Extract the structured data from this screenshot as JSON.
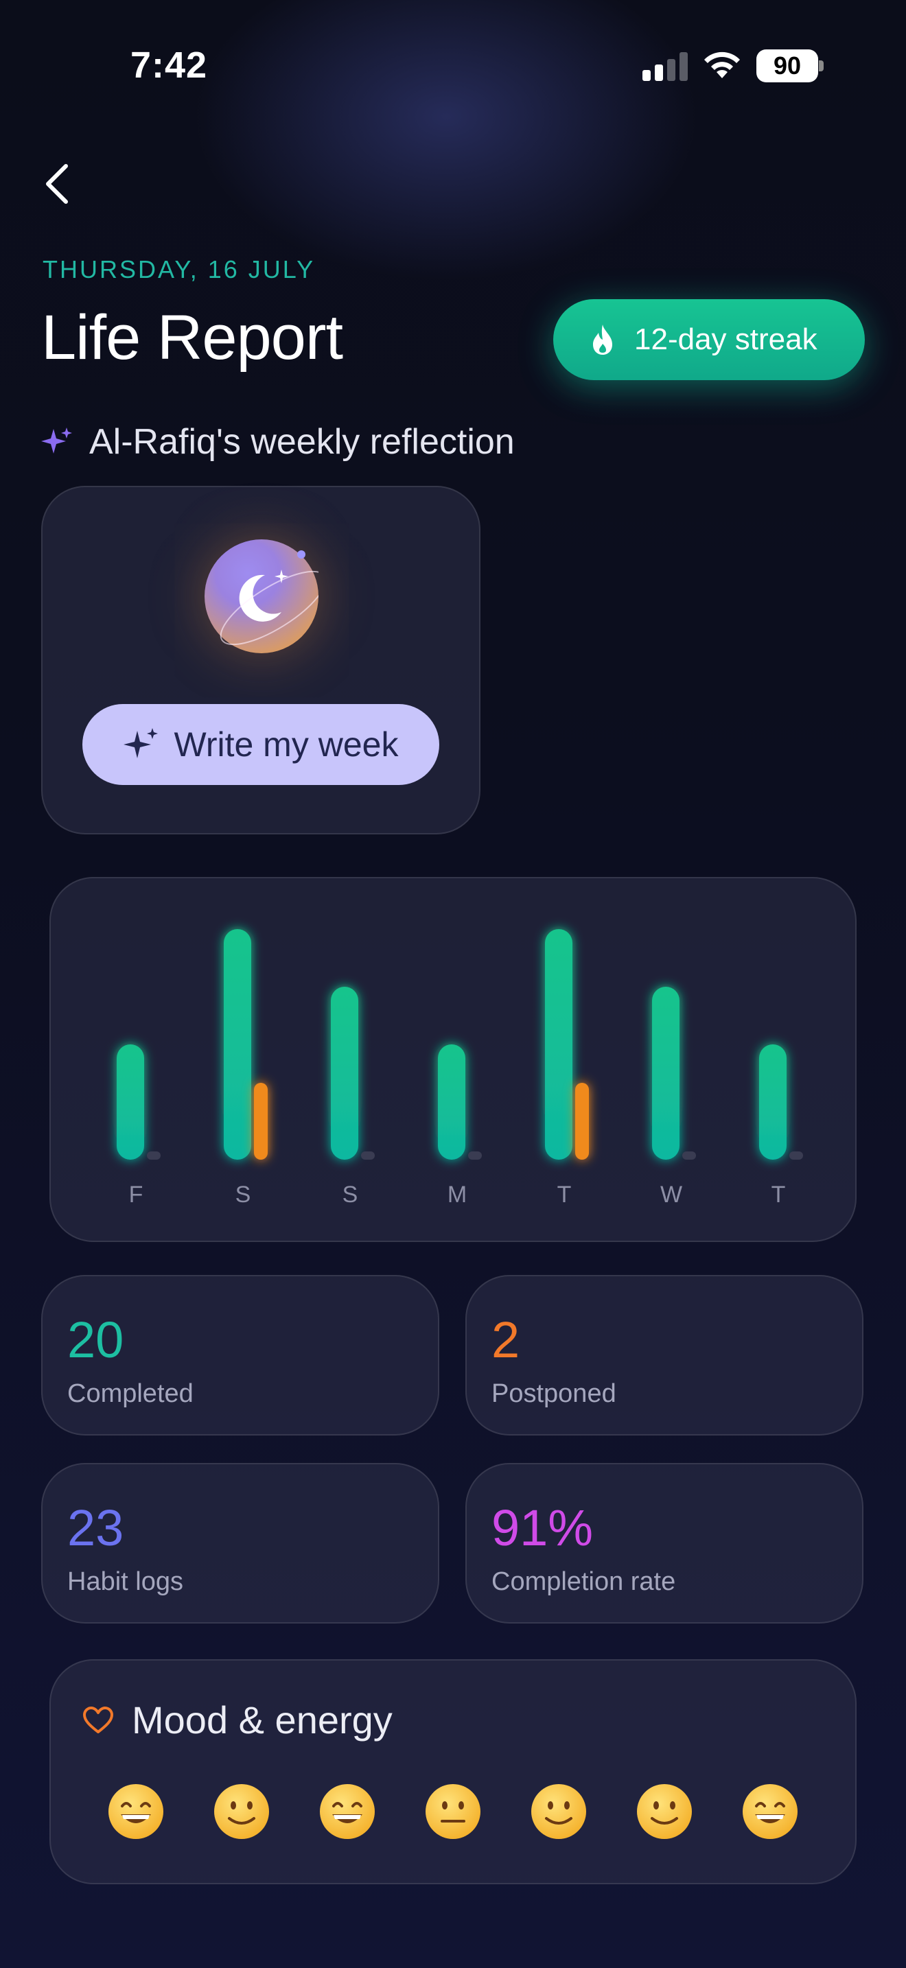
{
  "status_bar": {
    "time": "7:42",
    "battery": "90"
  },
  "header": {
    "date": "THURSDAY, 16 JULY",
    "title": "Life Report",
    "streak_label": "12-day streak"
  },
  "reflection": {
    "heading": "Al-Rafiq's weekly reflection",
    "button_label": "Write my week"
  },
  "chart_data": {
    "type": "bar",
    "categories": [
      "F",
      "S",
      "S",
      "M",
      "T",
      "W",
      "T"
    ],
    "series": [
      {
        "name": "Completed",
        "values": [
          2,
          4,
          3,
          2,
          4,
          3,
          2
        ]
      },
      {
        "name": "Postponed",
        "values": [
          0,
          1,
          0,
          0,
          1,
          0,
          0
        ]
      }
    ],
    "colors": {
      "completed": "#14C08F",
      "postponed": "#F08A1E",
      "empty": "#3A3C52"
    }
  },
  "stats": [
    {
      "value": "20",
      "label": "Completed",
      "color": "#1DBFA2"
    },
    {
      "value": "2",
      "label": "Postponed",
      "color": "#F2792A"
    },
    {
      "value": "23",
      "label": "Habit logs",
      "color": "#6B73F0"
    },
    {
      "value": "91%",
      "label": "Completion rate",
      "color": "#D04BE8"
    }
  ],
  "mood": {
    "title": "Mood & energy",
    "days": [
      "grin",
      "smile",
      "grin",
      "neutral",
      "smile",
      "smile",
      "grin"
    ]
  },
  "icons": {
    "back": "chevron-left-icon",
    "streak": "flame-icon",
    "reflection": "sparkles-icon",
    "mood": "heart-icon"
  }
}
